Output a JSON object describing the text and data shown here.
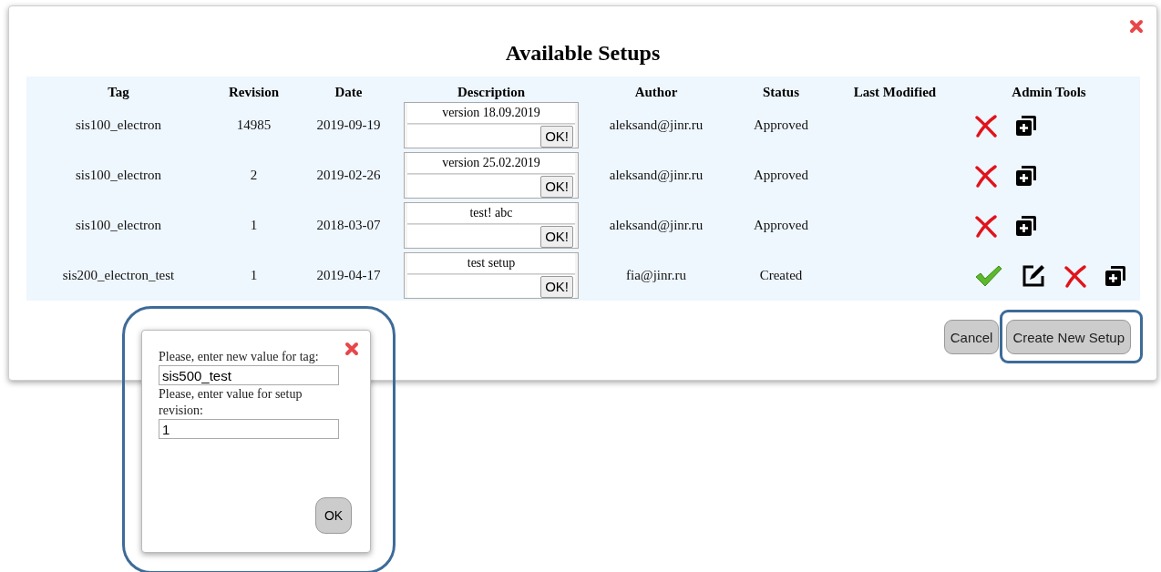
{
  "dialog": {
    "title": "Available Setups",
    "columns": [
      "Tag",
      "Revision",
      "Date",
      "Description",
      "Author",
      "Status",
      "Last Modified",
      "Admin Tools"
    ],
    "rows": [
      {
        "tag": "sis100_electron",
        "revision": "14985",
        "date": "2019-09-19",
        "description": "version 18.09.2019",
        "save_label": "OK!",
        "author": "aleksand@jinr.ru",
        "status": "Approved",
        "tools": [
          {
            "kind": "delete"
          },
          {
            "kind": "copy"
          }
        ]
      },
      {
        "tag": "sis100_electron",
        "revision": "2",
        "date": "2019-02-26",
        "description": "version 25.02.2019",
        "save_label": "OK!",
        "author": "aleksand@jinr.ru",
        "status": "Approved",
        "tools": [
          {
            "kind": "delete"
          },
          {
            "kind": "copy"
          }
        ]
      },
      {
        "tag": "sis100_electron",
        "revision": "1",
        "date": "2018-03-07",
        "description": "test! abc",
        "save_label": "OK!",
        "author": "aleksand@jinr.ru",
        "status": "Approved",
        "tools": [
          {
            "kind": "delete"
          },
          {
            "kind": "copy"
          }
        ]
      },
      {
        "tag": "sis200_electron_test",
        "revision": "1",
        "date": "2019-04-17",
        "description": "test setup",
        "save_label": "OK!",
        "author": "fia@jinr.ru",
        "status": "Created",
        "tools": [
          {
            "kind": "approve"
          },
          {
            "kind": "edit"
          },
          {
            "kind": "delete"
          },
          {
            "kind": "copy"
          }
        ]
      }
    ],
    "buttons": [
      {
        "label": "Cancel",
        "highlighted": false
      },
      {
        "label": "Create New Setup",
        "highlighted": true
      }
    ]
  },
  "prompt": {
    "highlighted": true,
    "fields": [
      {
        "label": "Please, enter new value for tag:",
        "value": "sis500_test"
      },
      {
        "label": "Please, enter value for setup revision:",
        "value": "1"
      }
    ],
    "button": "OK"
  }
}
